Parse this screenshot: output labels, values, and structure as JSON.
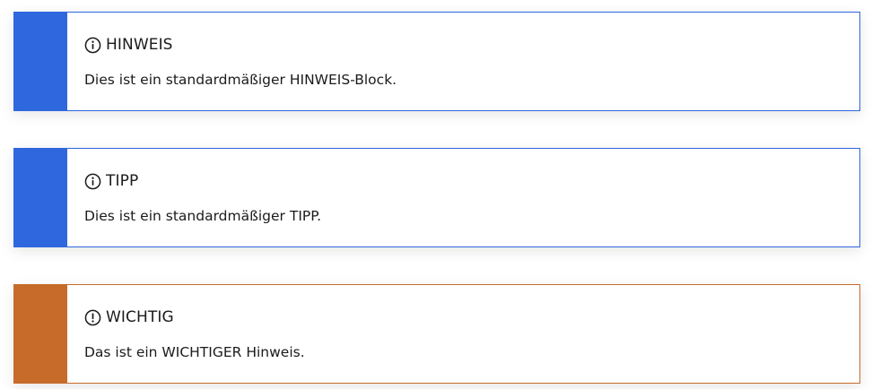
{
  "callouts": [
    {
      "type": "note",
      "icon": "info-icon",
      "accent_color": "#2f67de",
      "title": "HINWEIS",
      "body": "Dies ist ein standardmäßiger HINWEIS-Block."
    },
    {
      "type": "tip",
      "icon": "info-icon",
      "accent_color": "#2f67de",
      "title": "TIPP",
      "body": "Dies ist ein standardmäßiger TIPP."
    },
    {
      "type": "important",
      "icon": "exclamation-icon",
      "accent_color": "#c76b2a",
      "title": "WICHTIG",
      "body": "Das ist ein WICHTIGER Hinweis."
    }
  ]
}
